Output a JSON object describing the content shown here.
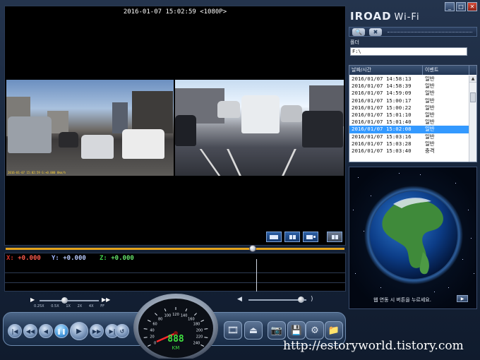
{
  "player": {
    "timestamp": "2016-01-07 15:02:59 <1080P>",
    "front_caption": "2016-01-07 15:02:59 G:+0.000  0km/h",
    "layout_buttons": [
      "single-view",
      "dual-view",
      "pip-view",
      "split-view"
    ]
  },
  "gsensor": {
    "x_label": "X:",
    "x_value": "+0.000",
    "y_label": "Y:",
    "y_value": "+0.000",
    "z_label": "Z:",
    "z_value": "+0.000"
  },
  "speed_control": {
    "labels": [
      "0.25X",
      "0.5X",
      "1X",
      "2X",
      "4X",
      "FF"
    ],
    "position": 0.42
  },
  "volume": {
    "level": 0.9
  },
  "playback": {
    "progress": 0.73,
    "buttons": [
      "first",
      "prev",
      "rewind",
      "pause",
      "play",
      "forward",
      "next",
      "last",
      "repeat"
    ]
  },
  "speedometer": {
    "ticks": [
      "0",
      "20",
      "40",
      "60",
      "80",
      "100",
      "120",
      "140",
      "160",
      "180",
      "200",
      "220",
      "240"
    ],
    "digital": "888",
    "unit": "KM"
  },
  "right_panel": {
    "brand": "IROAD",
    "brand_suffix": "Wi-Fi",
    "folder_label": "폴더",
    "folder_value": "F:\\",
    "list_headers": [
      "날짜/시간",
      "이벤트"
    ],
    "rows": [
      {
        "date": "2016/01/07 14:58:13",
        "event": "일반"
      },
      {
        "date": "2016/01/07 14:58:39",
        "event": "일반"
      },
      {
        "date": "2016/01/07 14:59:09",
        "event": "일반"
      },
      {
        "date": "2016/01/07 15:00:17",
        "event": "일반"
      },
      {
        "date": "2016/01/07 15:00:22",
        "event": "일반"
      },
      {
        "date": "2016/01/07 15:01:10",
        "event": "일반"
      },
      {
        "date": "2016/01/07 15:01:40",
        "event": "일반"
      },
      {
        "date": "2016/01/07 15:02:08",
        "event": "일반"
      },
      {
        "date": "2016/01/07 15:03:16",
        "event": "일반"
      },
      {
        "date": "2016/01/07 15:03:28",
        "event": "일반"
      },
      {
        "date": "2016/01/07 15:03:40",
        "event": "충격"
      }
    ],
    "selected_row": 7,
    "map_note": "웹 연동 시 버튼을 누르세요.",
    "map_button": "▶"
  },
  "watermark": "http://estoryworld.tistory.com",
  "colors": {
    "accent": "#3399ff",
    "progress": "#e3a31c",
    "x_axis": "#e0342a",
    "y_axis": "#9fb7ff",
    "z_axis": "#3fd24a",
    "speed_needle": "#ff2a2a",
    "digital": "#40e040"
  }
}
